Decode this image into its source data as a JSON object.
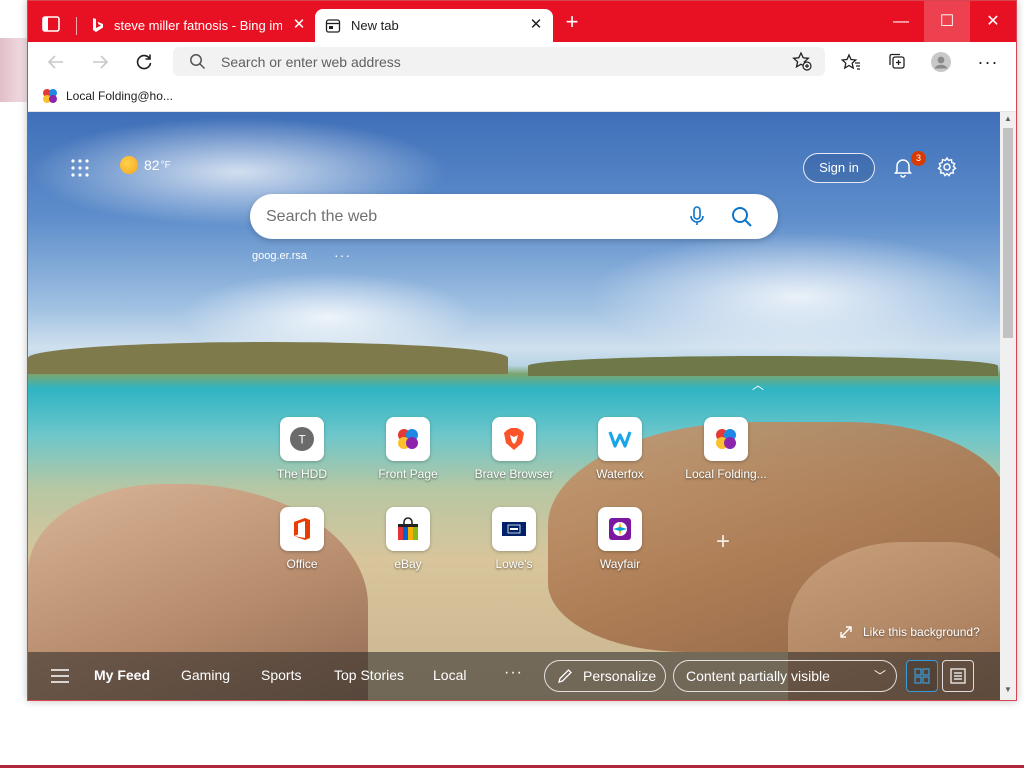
{
  "browser": {
    "tabs": [
      {
        "title": "steve miller fatnosis - Bing images",
        "favicon": "bing-icon",
        "active": false
      },
      {
        "title": "New tab",
        "favicon": "newtab-icon",
        "active": true
      }
    ],
    "new_tab_symbol": "+",
    "close_symbol": "✕",
    "window_controls": {
      "minimize": "—",
      "maximize": "☐",
      "close": "✕"
    },
    "accent_color": "#e81123"
  },
  "toolbar": {
    "address_placeholder": "Search or enter web address",
    "more_symbol": "···"
  },
  "favorites_bar": {
    "items": [
      {
        "label": "Local Folding@ho...",
        "icon": "folding-icon"
      }
    ]
  },
  "newtab": {
    "weather": {
      "temp": "82",
      "unit": "°F",
      "icon": "sun-icon"
    },
    "sign_in_label": "Sign in",
    "notification_count": "3",
    "search_placeholder": "Search the web",
    "suggestion": "goog.er.rsa",
    "suggestion_more": "···",
    "quick_links": [
      {
        "label": "The HDD",
        "icon": "letter-t-icon",
        "letter": "T"
      },
      {
        "label": "Front Page",
        "icon": "folding-icon"
      },
      {
        "label": "Brave Browser",
        "icon": "brave-icon"
      },
      {
        "label": "Waterfox",
        "icon": "waterfox-icon"
      },
      {
        "label": "Local Folding...",
        "icon": "folding-icon"
      },
      {
        "label": "Office",
        "icon": "office-icon"
      },
      {
        "label": "eBay",
        "icon": "ebay-icon"
      },
      {
        "label": "Lowe's",
        "icon": "lowes-icon"
      },
      {
        "label": "Wayfair",
        "icon": "wayfair-icon"
      }
    ],
    "add_symbol": "+",
    "like_background": "Like this background?",
    "feed_tabs": [
      "My Feed",
      "Gaming",
      "Sports",
      "Top Stories",
      "Local"
    ],
    "feed_more": "···",
    "personalize_label": "Personalize",
    "content_visibility": "Content partially visible"
  }
}
